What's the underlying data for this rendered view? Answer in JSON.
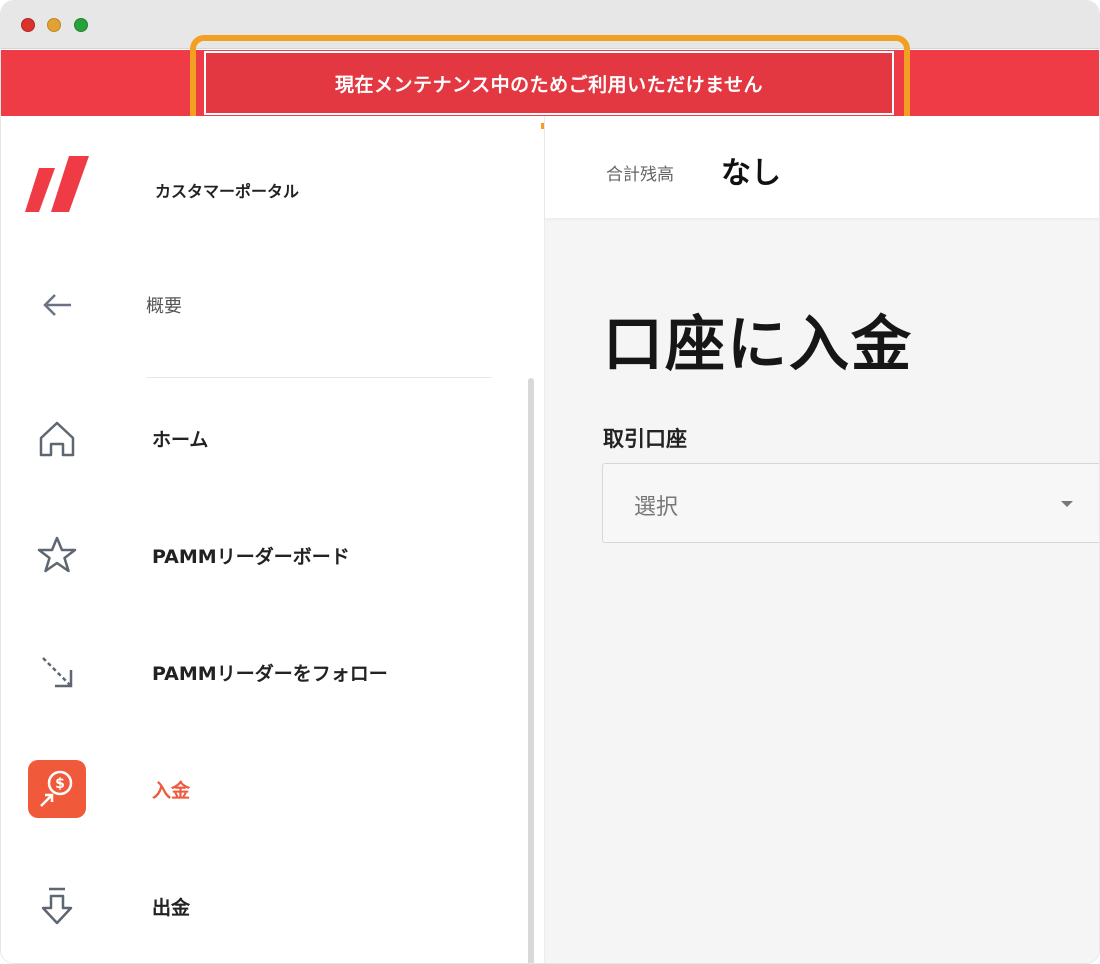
{
  "window": {
    "controls": [
      "close",
      "minimize",
      "maximize"
    ]
  },
  "banner": {
    "text": "現在メンテナンス中のためご利用いただけません",
    "background": "#ef3b45",
    "highlight_color": "#f2a024"
  },
  "sidebar": {
    "portal_title": "カスタマーポータル",
    "back_label": "概要",
    "items": [
      {
        "label": "ホーム",
        "icon": "home-icon"
      },
      {
        "label": "PAMMリーダーボード",
        "icon": "star-icon"
      },
      {
        "label": "PAMMリーダーをフォロー",
        "icon": "follow-arrow-icon"
      },
      {
        "label": "入金",
        "icon": "deposit-icon",
        "active": true
      },
      {
        "label": "出金",
        "icon": "withdraw-icon"
      }
    ],
    "accent_color": "#ef5a3c"
  },
  "header": {
    "balance_label": "合計残高",
    "balance_value": "なし"
  },
  "main": {
    "title": "口座に入金",
    "trading_account_label": "取引口座",
    "select_value": "選択"
  }
}
